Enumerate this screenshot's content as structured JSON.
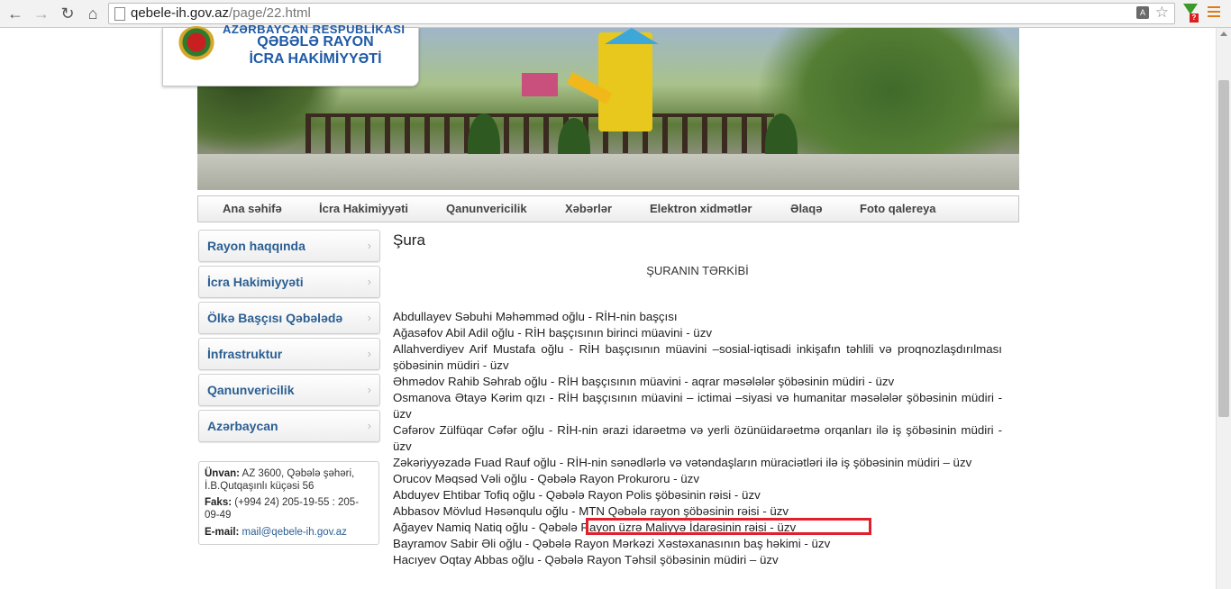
{
  "browser": {
    "url_host": "qebele-ih.gov.az",
    "url_path": "/page/22.html",
    "back_icon": "back-arrow-icon",
    "forward_icon": "forward-arrow-icon",
    "reload_icon": "reload-icon",
    "home_icon": "home-icon"
  },
  "header": {
    "logo_top": "AZƏRBAYCAN RESPUBLİKASI",
    "logo_line1": "QƏBƏLƏ RAYON",
    "logo_line2": "İCRA HAKİMİYYƏTİ"
  },
  "topnav": {
    "items": [
      "Ana səhifə",
      "İcra Hakimiyyəti",
      "Qanunvericilik",
      "Xəbərlər",
      "Elektron xidmətlər",
      "Əlaqə",
      "Foto qalereya"
    ]
  },
  "sidebar": {
    "items": [
      "Rayon haqqında",
      "İcra Hakimiyyəti",
      "Ölkə Başçısı Qəbələdə",
      "İnfrastruktur",
      "Qanunvericilik",
      "Azərbaycan"
    ]
  },
  "contact": {
    "address_label": "Ünvan:",
    "address_value": "AZ 3600, Qəbələ şəhəri, İ.B.Qutqaşınlı küçəsi 56",
    "fax_label": "Faks:",
    "fax_value": "(+994 24) 205-19-55 : 205-09-49",
    "email_label": "E-mail:",
    "email_value": "mail@qebele-ih.gov.az"
  },
  "content": {
    "title": "Şura",
    "subtitle": "ŞURANIN TƏRKİBİ",
    "members": [
      "Abdullayev Səbuhi Məhəmməd oğlu - RİH-nin başçısı",
      "Ağasəfov Abil Adil oğlu - RİH başçısının birinci müavini - üzv",
      "Allahverdiyev Arif Mustafa oğlu - RİH başçısının müavini –sosial-iqtisadi inkişafın təhlili və proqnozlaşdırılması şöbəsinin müdiri - üzv",
      "Əhmədov Rahib Səhrab oğlu - RİH başçısının müavini - aqrar məsələlər şöbəsinin müdiri - üzv",
      "Osmanova Ətayə Kərim qızı - RİH başçısının müavini – ictimai –siyasi və humanitar məsələlər şöbəsinin müdiri - üzv",
      "Cəfərov Zülfüqar Cəfər oğlu - RİH-nin ərazi idarəetmə və yerli özünüidarəetmə orqanları ilə iş şöbəsinin müdiri - üzv",
      "Zəkəriyyəzadə Fuad Rauf oğlu - RİH-nin sənədlərlə və vətəndaşların müraciətləri ilə iş şöbəsinin müdiri – üzv",
      "Orucov Məqsəd Vəli oğlu - Qəbələ Rayon Prokuroru - üzv",
      "Abduyev Ehtibar Tofiq oğlu - Qəbələ Rayon Polis şöbəsinin rəisi - üzv",
      "Abbasov Mövlud Həsənqulu oğlu - MTN Qəbələ rayon şöbəsinin rəisi - üzv",
      "Ağayev Namiq Natiq oğlu - Qəbələ Rayon üzrə Maliyyə İdarəsinin rəisi - üzv",
      "Bayramov Sabir Əli oğlu - Qəbələ Rayon Mərkəzi Xəstəxanasının baş həkimi - üzv",
      "Hacıyev Oqtay Abbas oğlu - Qəbələ Rayon Təhsil şöbəsinin müdiri – üzv"
    ]
  },
  "colors": {
    "link_blue": "#2b5f93",
    "highlight_red": "#e0202c"
  }
}
